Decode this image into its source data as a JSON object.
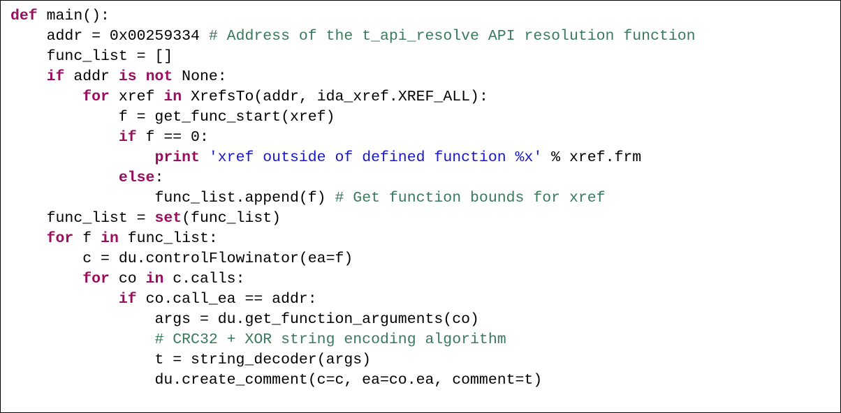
{
  "code": {
    "lines": [
      {
        "indent": 0,
        "segments": [
          {
            "cls": "tok-kw",
            "t": "def"
          },
          {
            "t": " main():"
          }
        ]
      },
      {
        "indent": 1,
        "segments": [
          {
            "t": "addr = 0x00259334 "
          },
          {
            "cls": "tok-comment",
            "t": "# Address of the t_api_resolve API resolution function"
          }
        ]
      },
      {
        "indent": 1,
        "segments": [
          {
            "t": "func_list = []"
          }
        ]
      },
      {
        "indent": 1,
        "segments": [
          {
            "cls": "tok-kw",
            "t": "if"
          },
          {
            "t": " addr "
          },
          {
            "cls": "tok-kw",
            "t": "is"
          },
          {
            "t": " "
          },
          {
            "cls": "tok-kw",
            "t": "not"
          },
          {
            "t": " None:"
          }
        ]
      },
      {
        "indent": 2,
        "segments": [
          {
            "cls": "tok-kw",
            "t": "for"
          },
          {
            "t": " xref "
          },
          {
            "cls": "tok-kw",
            "t": "in"
          },
          {
            "t": " XrefsTo(addr, ida_xref.XREF_ALL):"
          }
        ]
      },
      {
        "indent": 3,
        "segments": [
          {
            "t": "f = get_func_start(xref)"
          }
        ]
      },
      {
        "indent": 3,
        "segments": [
          {
            "cls": "tok-kw",
            "t": "if"
          },
          {
            "t": " f == 0:"
          }
        ]
      },
      {
        "indent": 4,
        "segments": [
          {
            "cls": "tok-kw",
            "t": "print"
          },
          {
            "t": " "
          },
          {
            "cls": "tok-string",
            "t": "'xref outside of defined function %x'"
          },
          {
            "t": " % xref.frm"
          }
        ]
      },
      {
        "indent": 3,
        "segments": [
          {
            "cls": "tok-kw",
            "t": "else"
          },
          {
            "t": ":"
          }
        ]
      },
      {
        "indent": 4,
        "segments": [
          {
            "t": "func_list.append(f) "
          },
          {
            "cls": "tok-comment",
            "t": "# Get function bounds for xref"
          }
        ]
      },
      {
        "indent": 1,
        "segments": [
          {
            "t": "func_list = "
          },
          {
            "cls": "tok-builtin",
            "t": "set"
          },
          {
            "t": "(func_list)"
          }
        ]
      },
      {
        "indent": 1,
        "segments": [
          {
            "cls": "tok-kw",
            "t": "for"
          },
          {
            "t": " f "
          },
          {
            "cls": "tok-kw",
            "t": "in"
          },
          {
            "t": " func_list:"
          }
        ]
      },
      {
        "indent": 2,
        "segments": [
          {
            "t": "c = du.controlFlowinator(ea=f)"
          }
        ]
      },
      {
        "indent": 2,
        "segments": [
          {
            "cls": "tok-kw",
            "t": "for"
          },
          {
            "t": " co "
          },
          {
            "cls": "tok-kw",
            "t": "in"
          },
          {
            "t": " c.calls:"
          }
        ]
      },
      {
        "indent": 3,
        "segments": [
          {
            "cls": "tok-kw",
            "t": "if"
          },
          {
            "t": " co.call_ea == addr:"
          }
        ]
      },
      {
        "indent": 4,
        "segments": [
          {
            "t": "args = du.get_function_arguments(co)"
          }
        ]
      },
      {
        "indent": 4,
        "segments": [
          {
            "cls": "tok-comment",
            "t": "# CRC32 + XOR string encoding algorithm"
          }
        ]
      },
      {
        "indent": 4,
        "segments": [
          {
            "t": "t = string_decoder(args)"
          }
        ]
      },
      {
        "indent": 4,
        "segments": [
          {
            "t": "du.create_comment(c=c, ea=co.ea, comment=t)"
          }
        ]
      }
    ],
    "indent_unit": "    "
  }
}
